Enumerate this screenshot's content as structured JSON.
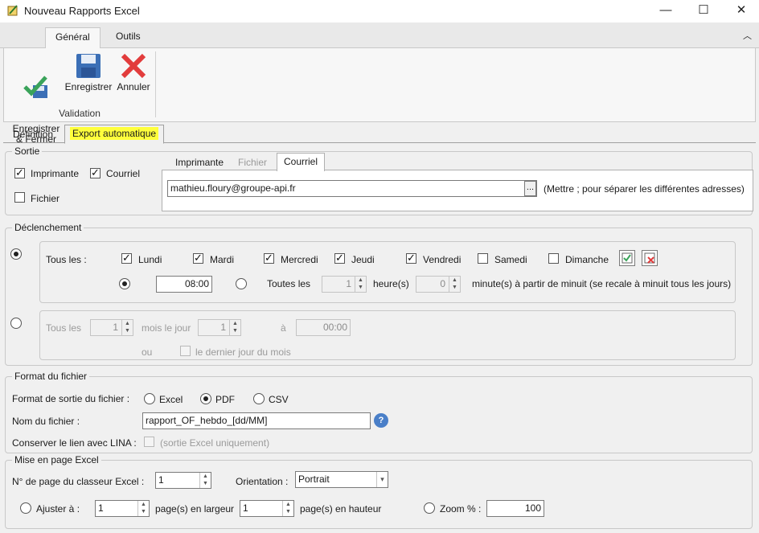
{
  "window": {
    "title": "Nouveau Rapports Excel",
    "minimize": "—",
    "maximize": "☐",
    "close": "✕"
  },
  "ribbon": {
    "tabs": [
      "Général",
      "Outils"
    ],
    "collapse": "︿",
    "buttons": {
      "save_close": "Enregistrer\n& Fermer",
      "save": "Enregistrer",
      "cancel": "Annuler"
    },
    "group_label": "Validation"
  },
  "subtabs": [
    "Définition",
    "Export automatique"
  ],
  "sortie": {
    "legend": "Sortie",
    "imprimante": {
      "label": "Imprimante",
      "checked": true
    },
    "courriel": {
      "label": "Courriel",
      "checked": true
    },
    "fichier": {
      "label": "Fichier",
      "checked": false
    },
    "tabs": [
      "Imprimante",
      "Fichier",
      "Courriel"
    ],
    "email": "mathieu.floury@groupe-api.fr",
    "browse": "...",
    "hint": "(Mettre ; pour séparer les différentes adresses)"
  },
  "declenchement": {
    "legend": "Déclenchement",
    "tous_les": "Tous les :",
    "days": [
      {
        "label": "Lundi",
        "checked": true
      },
      {
        "label": "Mardi",
        "checked": true
      },
      {
        "label": "Mercredi",
        "checked": true
      },
      {
        "label": "Jeudi",
        "checked": true
      },
      {
        "label": "Vendredi",
        "checked": true
      },
      {
        "label": "Samedi",
        "checked": false
      },
      {
        "label": "Dimanche",
        "checked": false
      }
    ],
    "time": "08:00",
    "toutes_les": "Toutes les",
    "hours_value": "1",
    "hours_label": "heure(s)",
    "minutes_value": "0",
    "minutes_label": "minute(s) à partir de minuit (se recale à minuit tous les jours)",
    "monthly": {
      "tous_les": "Tous les",
      "month_value": "1",
      "mois_le_jour": "mois le jour",
      "day_value": "1",
      "a": "à",
      "time": "00:00",
      "ou": "ou",
      "last_day": "le dernier jour du mois"
    }
  },
  "format": {
    "legend": "Format du fichier",
    "sortie_label": "Format de sortie du fichier :",
    "options": [
      "Excel",
      "PDF",
      "CSV"
    ],
    "selected": "PDF",
    "nom_label": "Nom du fichier :",
    "nom_value": "rapport_OF_hebdo_[dd/MM]",
    "lien_label": "Conserver le lien avec LINA :",
    "lien_hint": "(sortie Excel uniquement)"
  },
  "mise_en_page": {
    "legend": "Mise en page Excel",
    "page_label": "N° de page du classeur Excel :",
    "page_value": "1",
    "orientation_label": "Orientation :",
    "orientation_value": "Portrait",
    "ajuster_label": "Ajuster à :",
    "largeur_value": "1",
    "largeur_label": "page(s) en largeur",
    "hauteur_value": "1",
    "hauteur_label": "page(s) en hauteur",
    "zoom_label": "Zoom % :",
    "zoom_value": "100"
  },
  "colors": {
    "highlight": "#ffff3c",
    "check_green": "#3aa35a",
    "save_blue": "#3b6fb6",
    "cancel_red": "#e23c3c"
  }
}
